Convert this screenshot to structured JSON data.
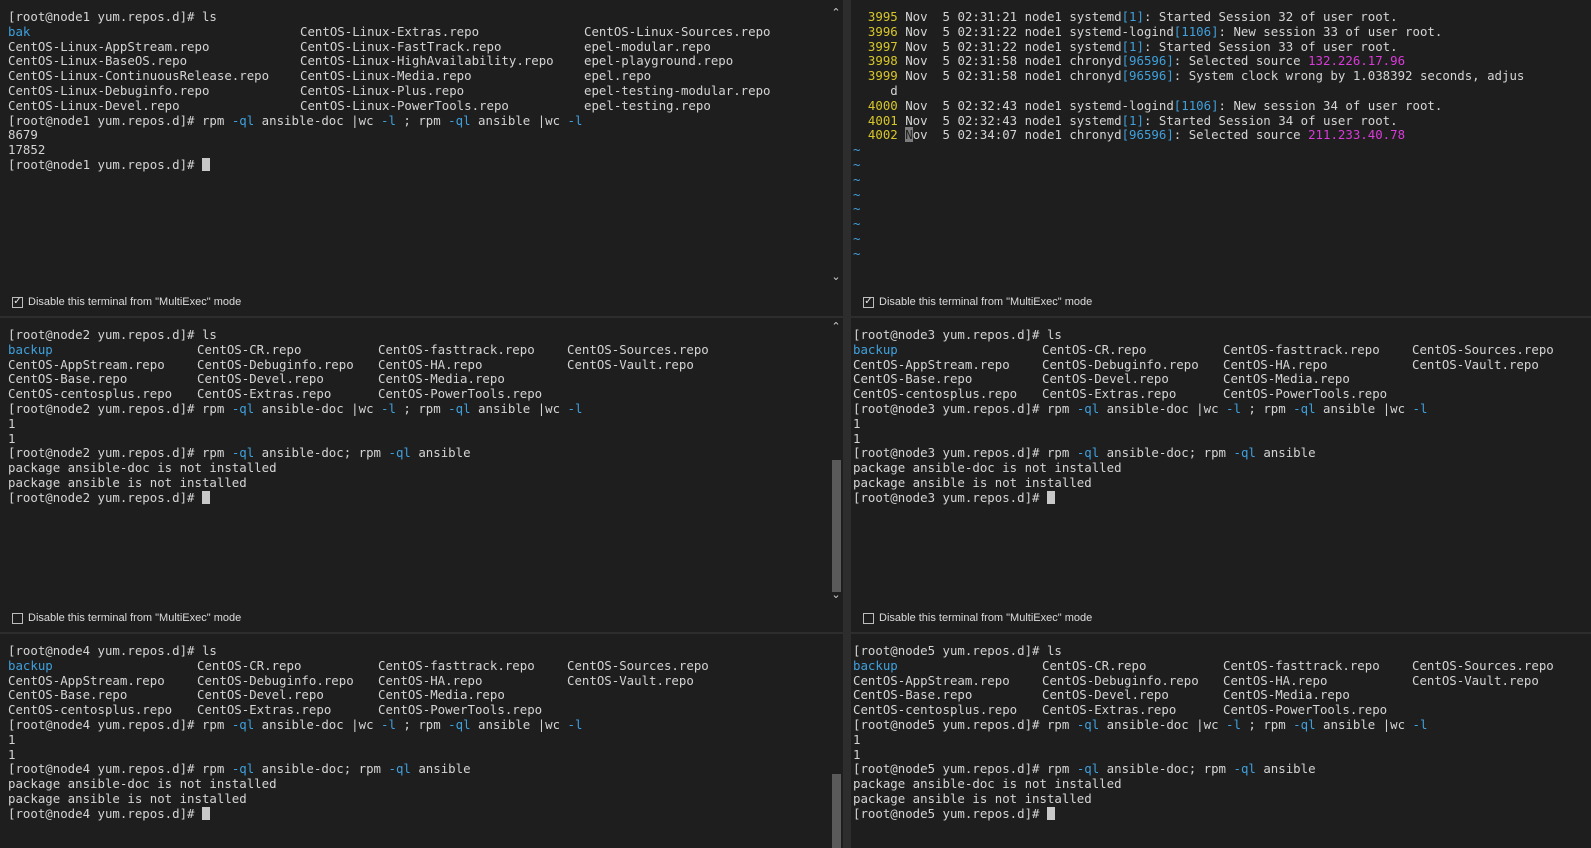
{
  "panes": {
    "node1": {
      "multiexec_label": "Disable this terminal from \"MultiExec\" mode",
      "multiexec_checked": true,
      "prompt1": "[root@node1 yum.repos.d]# ls",
      "ls_rows": [
        [
          "bak",
          "CentOS-Linux-Extras.repo",
          "CentOS-Linux-Sources.repo"
        ],
        [
          "CentOS-Linux-AppStream.repo",
          "CentOS-Linux-FastTrack.repo",
          "epel-modular.repo"
        ],
        [
          "CentOS-Linux-BaseOS.repo",
          "CentOS-Linux-HighAvailability.repo",
          "epel-playground.repo"
        ],
        [
          "CentOS-Linux-ContinuousRelease.repo",
          "CentOS-Linux-Media.repo",
          "epel.repo"
        ],
        [
          "CentOS-Linux-Debuginfo.repo",
          "CentOS-Linux-Plus.repo",
          "epel-testing-modular.repo"
        ],
        [
          "CentOS-Linux-Devel.repo",
          "CentOS-Linux-PowerTools.repo",
          "epel-testing.repo"
        ]
      ],
      "cmd_prompt": "[root@node1 yum.repos.d]# ",
      "cmd_parts": [
        "rpm ",
        "-ql",
        " ansible-doc |wc ",
        "-l",
        " ; rpm ",
        "-ql",
        " ansible |wc ",
        "-l"
      ],
      "out1": "8679",
      "out2": "17852",
      "final_prompt": "[root@node1 yum.repos.d]# "
    },
    "journal": {
      "multiexec_label": "Disable this terminal from \"MultiExec\" mode",
      "multiexec_checked": true,
      "lines": [
        {
          "num": "3995",
          "a": " Nov  5 02:31:21 node1 systemd",
          "pid": "[1]",
          "b": ": Started Session 32 of user root.",
          "ip": ""
        },
        {
          "num": "3996",
          "a": " Nov  5 02:31:22 node1 systemd-logind",
          "pid": "[1106]",
          "b": ": New session 33 of user root.",
          "ip": ""
        },
        {
          "num": "3997",
          "a": " Nov  5 02:31:22 node1 systemd",
          "pid": "[1]",
          "b": ": Started Session 33 of user root.",
          "ip": ""
        },
        {
          "num": "3998",
          "a": " Nov  5 02:31:58 node1 chronyd",
          "pid": "[96596]",
          "b": ": Selected source ",
          "ip": "132.226.17.96"
        },
        {
          "num": "3999",
          "a": " Nov  5 02:31:58 node1 chronyd",
          "pid": "[96596]",
          "b": ": System clock wrong by 1.038392 seconds, adjus",
          "ip": ""
        },
        {
          "num": "",
          "a": "     d",
          "pid": "",
          "b": "",
          "ip": ""
        },
        {
          "num": "4000",
          "a": " Nov  5 02:32:43 node1 systemd-logind",
          "pid": "[1106]",
          "b": ": New session 34 of user root.",
          "ip": ""
        },
        {
          "num": "4001",
          "a": " Nov  5 02:32:43 node1 systemd",
          "pid": "[1]",
          "b": ": Started Session 34 of user root.",
          "ip": ""
        },
        {
          "num": "4002",
          "a": " Nov  5 02:34:07 node1 chronyd",
          "pid": "[96596]",
          "b": ": Selected source ",
          "ip": "211.233.40.78"
        }
      ],
      "tilde": "~"
    },
    "node2": {
      "host": "node2",
      "multiexec_label": "Disable this terminal from \"MultiExec\" mode",
      "multiexec_checked": false
    },
    "node3": {
      "host": "node3",
      "multiexec_label": "Disable this terminal from \"MultiExec\" mode",
      "multiexec_checked": false
    },
    "node4": {
      "host": "node4",
      "multiexec_label": "Disable this terminal from \"MultiExec\" mode",
      "multiexec_checked": false
    },
    "node5": {
      "host": "node5",
      "multiexec_label": "Disable this terminal from \"MultiExec\" mode",
      "multiexec_checked": false
    }
  },
  "centos_ls_rows": [
    [
      "backup",
      "CentOS-CR.repo",
      "CentOS-fasttrack.repo",
      "CentOS-Sources.repo"
    ],
    [
      "CentOS-AppStream.repo",
      "CentOS-Debuginfo.repo",
      "CentOS-HA.repo",
      "CentOS-Vault.repo"
    ],
    [
      "CentOS-Base.repo",
      "CentOS-Devel.repo",
      "CentOS-Media.repo",
      ""
    ],
    [
      "CentOS-centosplus.repo",
      "CentOS-Extras.repo",
      "CentOS-PowerTools.repo",
      ""
    ]
  ],
  "common": {
    "ls_cmd": "ls",
    "prompt_tail": " yum.repos.d]# ",
    "cmd1_parts": [
      "rpm ",
      "-ql",
      " ansible-doc |wc ",
      "-l",
      " ; rpm ",
      "-ql",
      " ansible |wc ",
      "-l"
    ],
    "cmd1_out1": "1",
    "cmd1_out2": "1",
    "cmd2_parts": [
      "rpm ",
      "-ql",
      " ansible-doc; rpm ",
      "-ql",
      " ansible"
    ],
    "msg1": "package ansible-doc is not installed",
    "msg2": "package ansible is not installed"
  },
  "icons": {
    "scroll_up": "chevron-up-icon",
    "scroll_down": "chevron-down-icon",
    "checkbox": "checkbox-icon"
  }
}
